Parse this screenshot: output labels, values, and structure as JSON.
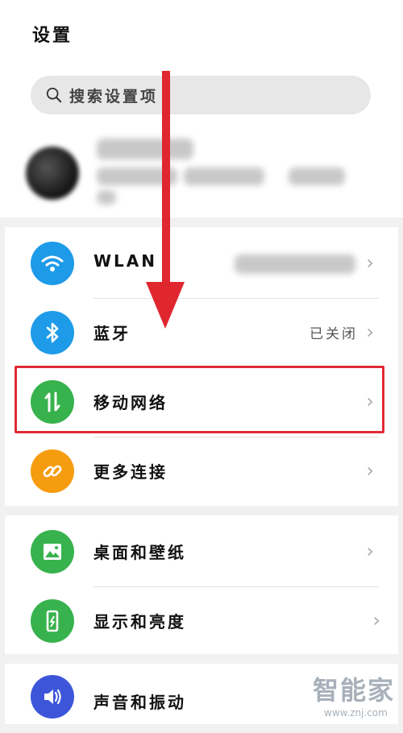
{
  "header": {
    "title": "设置"
  },
  "search": {
    "placeholder": "搜索设置项"
  },
  "sections": [
    {
      "items": [
        {
          "label": "WLAN",
          "value": "",
          "icon": "wifi-icon",
          "color": "#1e9be8"
        },
        {
          "label": "蓝牙",
          "value": "已关闭",
          "icon": "bluetooth-icon",
          "color": "#1e9be8"
        },
        {
          "label": "移动网络",
          "value": "",
          "icon": "mobile-data-icon",
          "color": "#37b24d"
        },
        {
          "label": "更多连接",
          "value": "",
          "icon": "link-icon",
          "color": "#f59c0f"
        }
      ]
    },
    {
      "items": [
        {
          "label": "桌面和壁纸",
          "value": "",
          "icon": "wallpaper-icon",
          "color": "#37b24d"
        },
        {
          "label": "显示和亮度",
          "value": "",
          "icon": "display-icon",
          "color": "#37b24d"
        }
      ]
    },
    {
      "items": [
        {
          "label": "声音和振动",
          "value": "",
          "icon": "sound-icon",
          "color": "#3d56d9"
        }
      ]
    }
  ],
  "colors": {
    "highlight": "#e02a35",
    "arrow": "#e0262f"
  },
  "watermark": {
    "main": "智能家",
    "sub": "www.znj.com"
  }
}
